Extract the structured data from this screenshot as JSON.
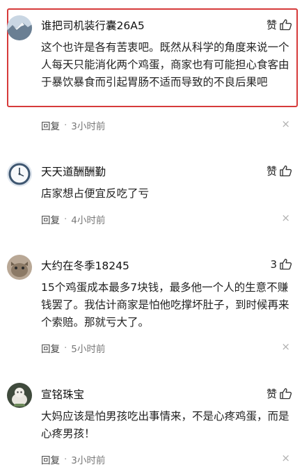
{
  "comments": [
    {
      "username": "谁把司机装行囊26A5",
      "like_label": "赞",
      "body": "这个也许是各有苦衷吧。既然从科学的角度来说一个人每天只能消化两个鸡蛋，商家也有可能担心食客由于暴饮暴食而引起胃肠不适而导致的不良后果吧",
      "reply_label": "回复",
      "dot": "·",
      "time": "3小时前",
      "close_glyph": "×"
    },
    {
      "username": "天天道酬酬勤",
      "like_label": "赞",
      "body": "店家想占便宜反吃了亏",
      "reply_label": "回复",
      "dot": "·",
      "time": "4小时前",
      "close_glyph": "×"
    },
    {
      "username": "大约在冬季18245",
      "like_label": "3",
      "body": "15个鸡蛋成本最多7块钱，最多他一个人的生意不赚钱罢了。我估计商家是怕他吃撑坏肚子，到时候再来个索赔。那就亏大了。",
      "reply_label": "回复",
      "dot": "·",
      "time": "5小时前",
      "close_glyph": "×"
    },
    {
      "username": "宣铭珠宝",
      "like_label": "赞",
      "body": "大妈应该是怕男孩吃出事情来，不是心疼鸡蛋，而是心疼男孩！",
      "reply_label": "回复",
      "dot": "·",
      "time": "3小时前",
      "close_glyph": "×"
    }
  ],
  "colors": {
    "highlight_border": "#d63a3a",
    "meta_text": "#777777"
  },
  "icons": {
    "like": "thumbs-up-icon",
    "close": "close-icon"
  }
}
